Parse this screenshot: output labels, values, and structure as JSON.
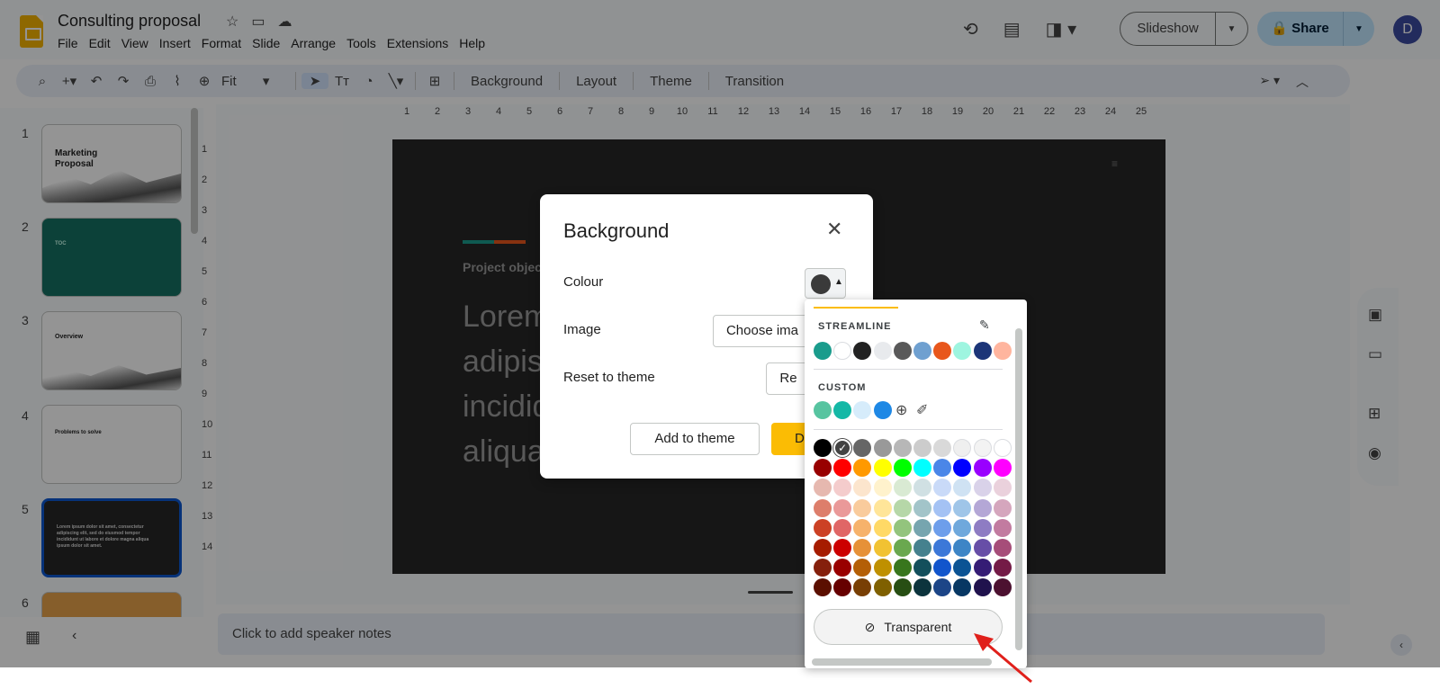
{
  "app": {
    "doc_title": "Consulting proposal",
    "menu": [
      "File",
      "Edit",
      "View",
      "Insert",
      "Format",
      "Slide",
      "Arrange",
      "Tools",
      "Extensions",
      "Help"
    ],
    "slideshow_label": "Slideshow",
    "share_label": "Share",
    "avatar_letter": "D"
  },
  "toolbar": {
    "zoom": "Fit",
    "background": "Background",
    "layout": "Layout",
    "theme": "Theme",
    "transition": "Transition"
  },
  "thumbnails": [
    {
      "num": "1",
      "title": "Marketing Proposal"
    },
    {
      "num": "2",
      "title": "TOC"
    },
    {
      "num": "3",
      "title": "Overview"
    },
    {
      "num": "4",
      "title": "Problems to solve"
    },
    {
      "num": "5",
      "title": "Lorem ipsum dolor sit amet, consectetur adipiscing elit, sed do eiusmod tempor incididunt ut labore et dolore magna aliqua ipsum dolor sit amet."
    },
    {
      "num": "6",
      "title": ""
    }
  ],
  "ruler": {
    "h": [
      "1",
      "2",
      "3",
      "4",
      "5",
      "6",
      "7",
      "8",
      "9",
      "10",
      "11",
      "12",
      "13",
      "14",
      "15",
      "16",
      "17",
      "18",
      "19",
      "20",
      "21",
      "22",
      "23",
      "24",
      "25"
    ],
    "v": [
      "1",
      "2",
      "3",
      "4",
      "5",
      "6",
      "7",
      "8",
      "9",
      "10",
      "11",
      "12",
      "13",
      "14"
    ]
  },
  "slide": {
    "subtitle": "Project objec",
    "body_lines": [
      "Lorem",
      "adipis",
      "incidid",
      "aliqua"
    ]
  },
  "notes_placeholder": "Click to add speaker notes",
  "dialog": {
    "title": "Background",
    "colour_label": "Colour",
    "image_label": "Image",
    "choose_image": "Choose ima",
    "reset_label": "Reset to theme",
    "reset_button": "Re",
    "add_to_theme": "Add to theme",
    "done": "D",
    "current_colour": "#3a3a3a"
  },
  "picker": {
    "streamline_label": "STREAMLINE",
    "custom_label": "CUSTOM",
    "transparent_label": "Transparent",
    "streamline": [
      "#1a9c8c",
      "#ffffff",
      "#222222",
      "#e8eaed",
      "#595959",
      "#6fa0d0",
      "#e8571c",
      "#9ef5e0",
      "#1c3578",
      "#ffb59e"
    ],
    "custom": [
      "#57c4a0",
      "#14b8a6",
      "#d6ecfb",
      "#1e88e5"
    ],
    "standard": [
      [
        "#000000",
        "#434343",
        "#666666",
        "#999999",
        "#b7b7b7",
        "#cccccc",
        "#d9d9d9",
        "#efefef",
        "#f3f3f3",
        "#ffffff"
      ],
      [
        "#980000",
        "#ff0000",
        "#ff9900",
        "#ffff00",
        "#00ff00",
        "#00ffff",
        "#4a86e8",
        "#0000ff",
        "#9900ff",
        "#ff00ff"
      ],
      [
        "#e6b8af",
        "#f4cccc",
        "#fce5cd",
        "#fff2cc",
        "#d9ead3",
        "#d0e0e3",
        "#c9daf8",
        "#cfe2f3",
        "#d9d2e9",
        "#ead1dc"
      ],
      [
        "#dd7e6b",
        "#ea9999",
        "#f9cb9c",
        "#ffe599",
        "#b6d7a8",
        "#a2c4c9",
        "#a4c2f4",
        "#9fc5e8",
        "#b4a7d6",
        "#d5a6bd"
      ],
      [
        "#cc4125",
        "#e06666",
        "#f6b26b",
        "#ffd966",
        "#93c47d",
        "#76a5af",
        "#6d9eeb",
        "#6fa8dc",
        "#8e7cc3",
        "#c27ba0"
      ],
      [
        "#a61c00",
        "#cc0000",
        "#e69138",
        "#f1c232",
        "#6aa84f",
        "#45818e",
        "#3c78d8",
        "#3d85c6",
        "#674ea7",
        "#a64d79"
      ],
      [
        "#85200c",
        "#990000",
        "#b45f06",
        "#bf9000",
        "#38761d",
        "#134f5c",
        "#1155cc",
        "#0b5394",
        "#351c75",
        "#741b47"
      ],
      [
        "#5b0f00",
        "#660000",
        "#783f04",
        "#7f6000",
        "#274e13",
        "#0c343d",
        "#1c4587",
        "#073763",
        "#20124d",
        "#4c1130"
      ]
    ],
    "selected": "#434343"
  }
}
